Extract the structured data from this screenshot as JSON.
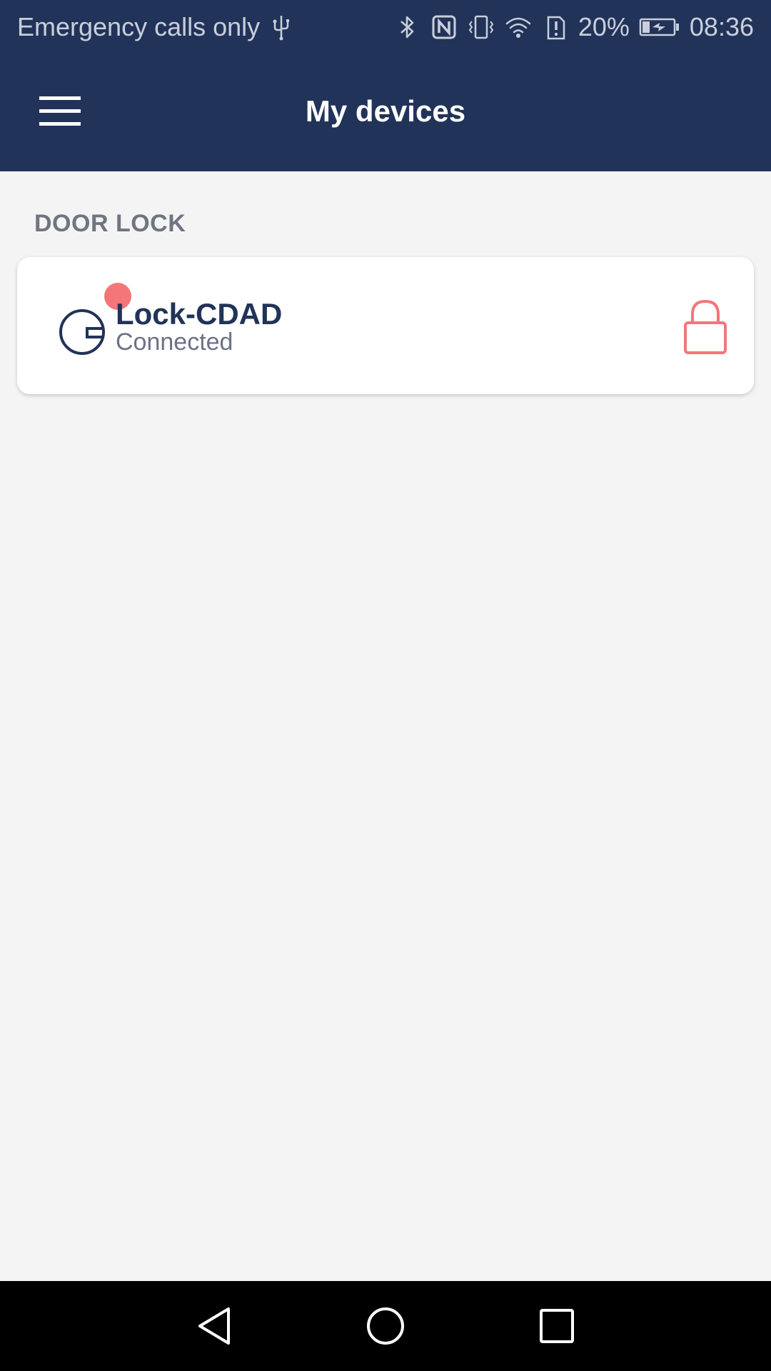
{
  "status_bar": {
    "carrier_text": "Emergency calls only",
    "battery_percent": "20%",
    "time": "08:36",
    "icons": [
      "usb-icon",
      "bluetooth-icon",
      "nfc-icon",
      "vibrate-icon",
      "wifi-icon",
      "battery-alert-icon",
      "battery-charging-icon"
    ]
  },
  "app_bar": {
    "title": "My devices",
    "menu_icon": "hamburger-menu-icon"
  },
  "section": {
    "header": "DOOR LOCK"
  },
  "device": {
    "name": "Lock-CDAD",
    "status": "Connected",
    "icon": "door-lock-device-icon",
    "action_icon": "padlock-icon"
  },
  "nav_bar": {
    "icons": [
      "back-icon",
      "home-icon",
      "recents-icon"
    ]
  },
  "colors": {
    "primary": "#223359",
    "accent": "#f47679",
    "background": "#f4f4f4",
    "card": "#ffffff"
  }
}
